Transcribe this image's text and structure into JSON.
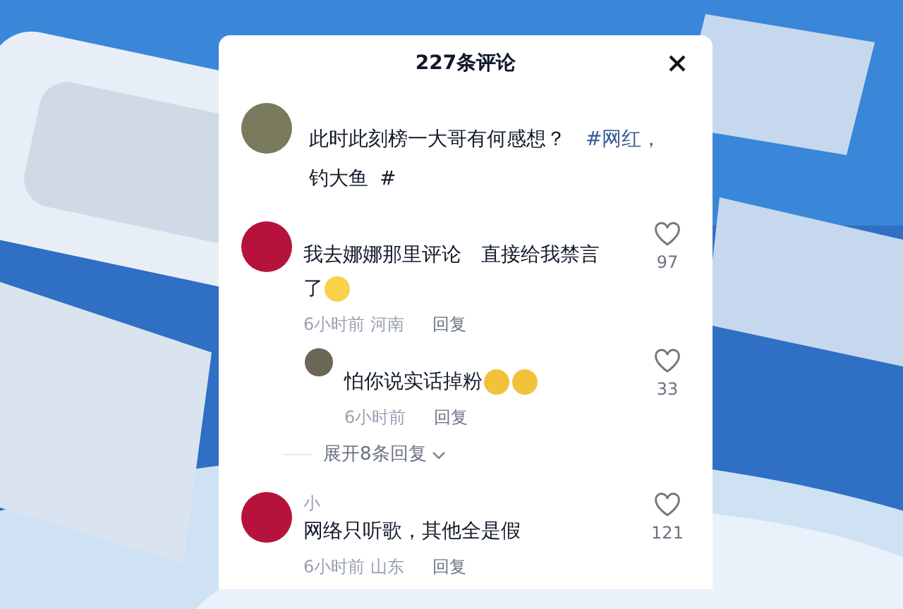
{
  "panel": {
    "title": "227条评论"
  },
  "post": {
    "text": "此时此刻榜一大哥有何感想？",
    "tags": [
      "#网红，",
      "钓大鱼",
      "#"
    ]
  },
  "comments": [
    {
      "kind": "comment",
      "text": "我去娜娜那里评论　直接给我禁言了",
      "emojis": [
        {
          "kind": "crying"
        }
      ],
      "time": "6小时前",
      "location": "河南",
      "reply": "回复",
      "likes": "97"
    },
    {
      "kind": "reply",
      "text": "怕你说实话掉粉",
      "emojis": [
        {
          "kind": "grin"
        },
        {
          "kind": "grin"
        }
      ],
      "time": "6小时前",
      "reply": "回复",
      "likes": "33"
    },
    {
      "kind": "expand",
      "text": "展开8条回复"
    },
    {
      "kind": "comment",
      "name": "小",
      "text": "网络只听歌，其他全是假",
      "time": "6小时前",
      "location": "山东",
      "reply": "回复",
      "likes": "121"
    }
  ]
}
